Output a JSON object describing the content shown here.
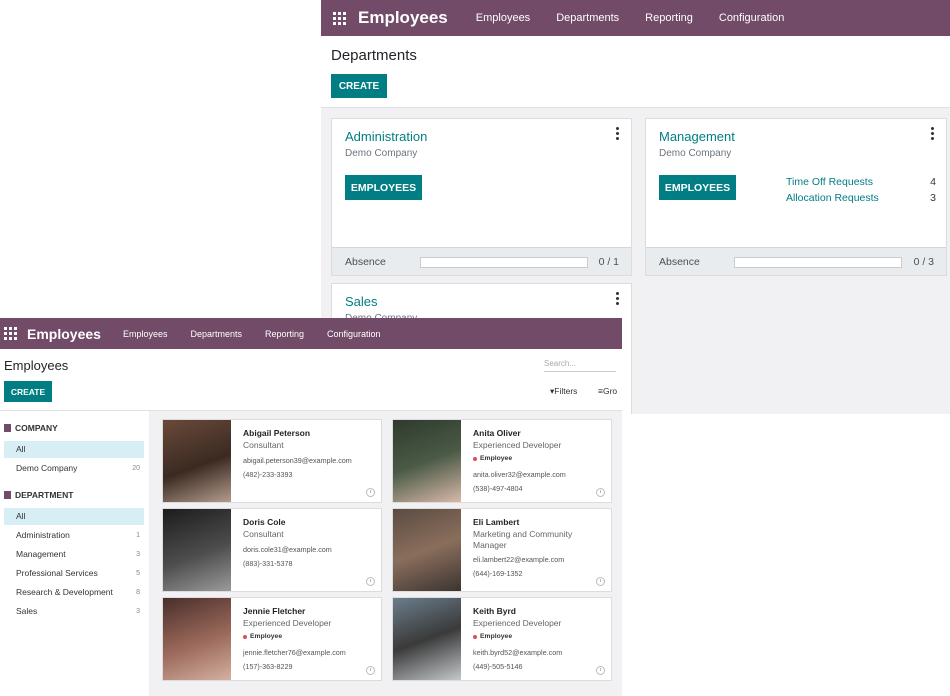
{
  "back_window": {
    "app_title": "Employees",
    "menu": [
      "Employees",
      "Departments",
      "Reporting",
      "Configuration"
    ],
    "page_title": "Departments",
    "create_label": "CREATE",
    "departments": [
      {
        "name": "Administration",
        "company": "Demo Company",
        "button_label": "EMPLOYEES",
        "absence_label": "Absence",
        "absence_value": "0 / 1",
        "absence_progress": 0
      },
      {
        "name": "Management",
        "company": "Demo Company",
        "button_label": "EMPLOYEES",
        "requests": [
          {
            "label": "Time Off Requests",
            "count": "4"
          },
          {
            "label": "Allocation Requests",
            "count": "3"
          }
        ],
        "absence_label": "Absence",
        "absence_value": "0 / 3",
        "absence_progress": 0
      },
      {
        "name": "Sales",
        "company": "Demo Company"
      }
    ]
  },
  "front_window": {
    "app_title": "Employees",
    "menu": [
      "Employees",
      "Departments",
      "Reporting",
      "Configuration"
    ],
    "page_title": "Employees",
    "search_placeholder": "Search...",
    "create_label": "CREATE",
    "filters_label": "Filters",
    "groupby_label": "Gro",
    "sidebar": {
      "company_heading": "COMPANY",
      "company_items": [
        {
          "label": "All",
          "count": ""
        },
        {
          "label": "Demo Company",
          "count": "20"
        }
      ],
      "department_heading": "DEPARTMENT",
      "department_items": [
        {
          "label": "All",
          "count": ""
        },
        {
          "label": "Administration",
          "count": "1"
        },
        {
          "label": "Management",
          "count": "3"
        },
        {
          "label": "Professional Services",
          "count": "5"
        },
        {
          "label": "Research & Development",
          "count": "8"
        },
        {
          "label": "Sales",
          "count": "3"
        }
      ]
    },
    "employees": [
      {
        "name": "Abigail Peterson",
        "job": "Consultant",
        "tag": "",
        "email": "abigail.peterson39@example.com",
        "phone": "(482)-233-3393"
      },
      {
        "name": "Anita Oliver",
        "job": "Experienced Developer",
        "tag": "Employee",
        "email": "anita.oliver32@example.com",
        "phone": "(538)-497-4804"
      },
      {
        "name": "Doris Cole",
        "job": "Consultant",
        "tag": "",
        "email": "doris.cole31@example.com",
        "phone": "(883)-331-5378"
      },
      {
        "name": "Eli Lambert",
        "job": "Marketing and Community Manager",
        "tag": "",
        "email": "eli.lambert22@example.com",
        "phone": "(644)-169-1352"
      },
      {
        "name": "Jennie Fletcher",
        "job": "Experienced Developer",
        "tag": "Employee",
        "email": "jennie.fletcher76@example.com",
        "phone": "(157)-363-8229"
      },
      {
        "name": "Keith Byrd",
        "job": "Experienced Developer",
        "tag": "Employee",
        "email": "keith.byrd52@example.com",
        "phone": "(449)-505-5146"
      }
    ]
  },
  "colors": {
    "navbar": "#714b67",
    "primary": "#017e84",
    "link": "#017e84",
    "tag_dot": "#e04a5c",
    "sidebar_active": "#d7eef4"
  }
}
